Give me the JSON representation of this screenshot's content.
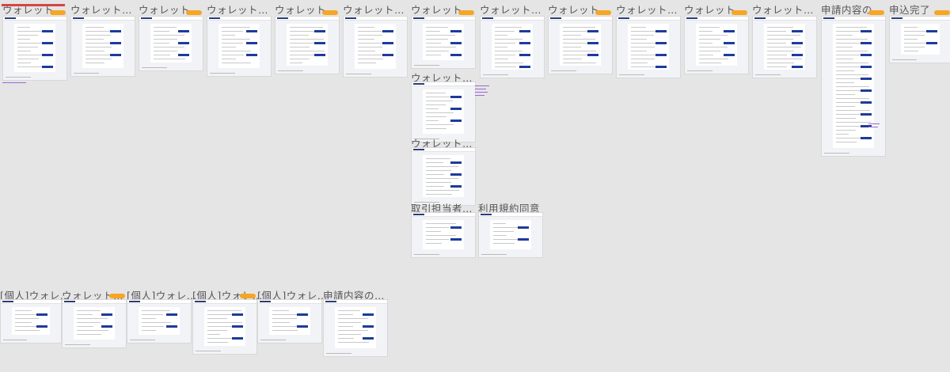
{
  "canvas": {
    "background": "#e5e5e5",
    "badge_color": "#f5a623",
    "frames": [
      {
        "title": "ウォレット…",
        "badge": true
      },
      {
        "title": "ウォレット…",
        "badge": false
      },
      {
        "title": "ウォレット…",
        "badge": true
      },
      {
        "title": "ウォレット…",
        "badge": false
      },
      {
        "title": "ウォレット…",
        "badge": true
      },
      {
        "title": "ウォレット…",
        "badge": false
      },
      {
        "title": "ウォレット…",
        "badge": true
      },
      {
        "title": "ウォレット…",
        "badge": false
      },
      {
        "title": "ウォレット…",
        "badge": true
      },
      {
        "title": "ウォレット…",
        "badge": false
      },
      {
        "title": "ウォレット…",
        "badge": true
      },
      {
        "title": "ウォレット…",
        "badge": false
      },
      {
        "title": "申請内容の…",
        "badge": true
      },
      {
        "title": "申込完了",
        "badge": true
      },
      {
        "title": "ウォレット…",
        "badge": false
      },
      {
        "title": "ウォレット…",
        "badge": false
      },
      {
        "title": "取引担当者…",
        "badge": false
      },
      {
        "title": "利用規約同意",
        "badge": false
      },
      {
        "title": "[個人]ウォレ…",
        "badge": false
      },
      {
        "title": "ウォレット…",
        "badge": true
      },
      {
        "title": "[個人]ウォレ…",
        "badge": false
      },
      {
        "title": "[個人]ウォレ…",
        "badge": true
      },
      {
        "title": "[個人]ウォレ…",
        "badge": false
      },
      {
        "title": "申請内容の…",
        "badge": false
      }
    ]
  }
}
